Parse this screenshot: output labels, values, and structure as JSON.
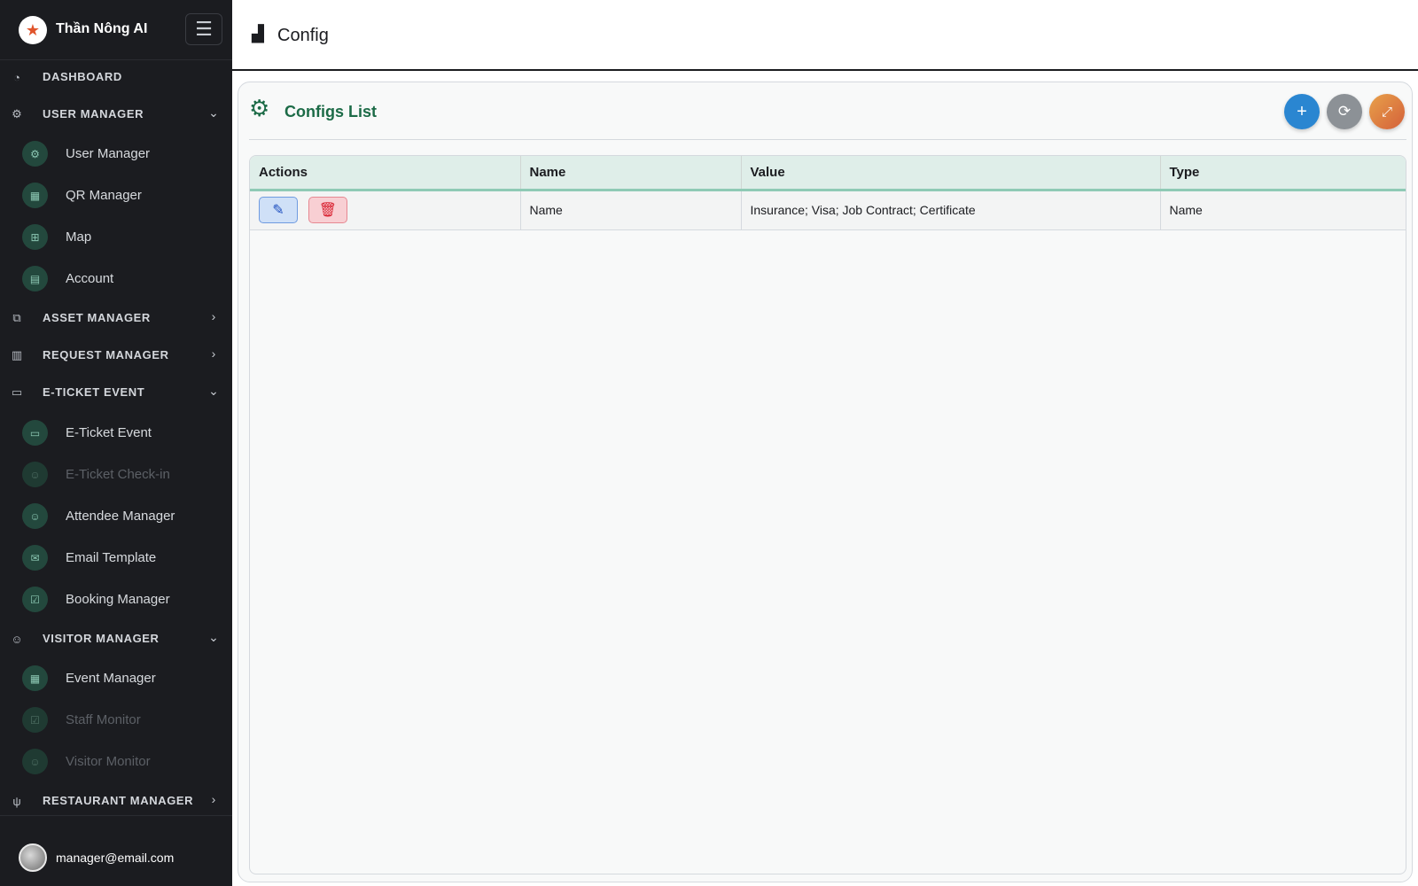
{
  "brand": {
    "name": "Thần Nông AI",
    "logo_icon": "star-logo-icon",
    "menu_icon": "hamburger-icon"
  },
  "sidebar": {
    "dashboard": {
      "label": "DASHBOARD"
    },
    "user_manager": {
      "label": "USER MANAGER",
      "items": [
        {
          "label": "User Manager"
        },
        {
          "label": "QR Manager"
        },
        {
          "label": "Map"
        },
        {
          "label": "Account"
        }
      ]
    },
    "asset_manager": {
      "label": "ASSET MANAGER"
    },
    "request_manager": {
      "label": "REQUEST MANAGER"
    },
    "eticket_event": {
      "label": "E-TICKET EVENT",
      "items": [
        {
          "label": "E-Ticket Event"
        },
        {
          "label": "E-Ticket Check-in"
        },
        {
          "label": "Attendee Manager"
        },
        {
          "label": "Email Template"
        },
        {
          "label": "Booking Manager"
        }
      ]
    },
    "visitor_manager": {
      "label": "VISITOR MANAGER",
      "items": [
        {
          "label": "Event Manager"
        },
        {
          "label": "Staff Monitor"
        },
        {
          "label": "Visitor Monitor"
        }
      ]
    },
    "restaurant_manager": {
      "label": "RESTAURANT MANAGER"
    }
  },
  "user": {
    "email": "manager@email.com"
  },
  "header": {
    "title": "Config"
  },
  "card": {
    "title": "Configs List",
    "add_symbol": "+",
    "refresh_symbol": "⟳",
    "expand_symbol": "⤢"
  },
  "table": {
    "columns": [
      "Actions",
      "Name",
      "Value",
      "Type"
    ],
    "rows": [
      {
        "name": "Name",
        "value": "Insurance; Visa; Job Contract; Certificate",
        "type": "Name"
      }
    ]
  },
  "colors": {
    "sidebar_bg": "#1b1c20",
    "accent_green": "#1c6b47",
    "add_button": "#2a86d1",
    "refresh_button": "#8c9196",
    "expand_button": "#e07a42",
    "table_header_bg": "#dfeee9"
  }
}
